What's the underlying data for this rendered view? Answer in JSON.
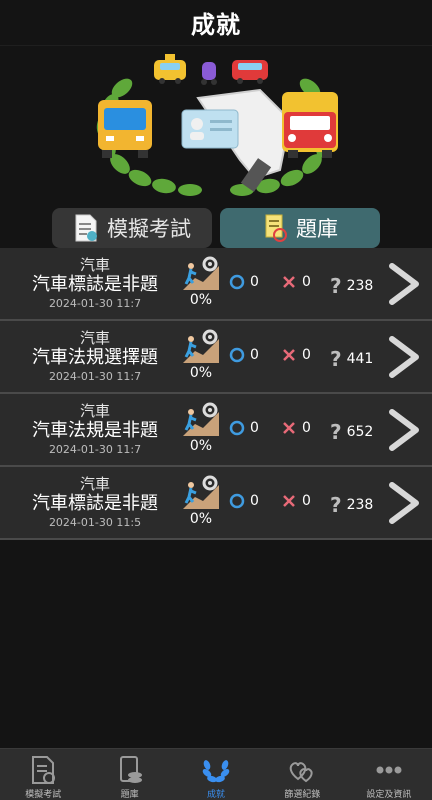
{
  "header": {
    "title": "成就"
  },
  "mode_toggle": {
    "exam_label": "模擬考試",
    "bank_label": "題庫",
    "selected": "bank"
  },
  "records": [
    {
      "category": "汽車",
      "title": "汽車標誌是非題",
      "date": "2024-01-30 11:7",
      "progress": "0%",
      "correct": "0",
      "wrong": "0",
      "unanswered": "238"
    },
    {
      "category": "汽車",
      "title": "汽車法規選擇題",
      "date": "2024-01-30 11:7",
      "progress": "0%",
      "correct": "0",
      "wrong": "0",
      "unanswered": "441"
    },
    {
      "category": "汽車",
      "title": "汽車法規是非題",
      "date": "2024-01-30 11:7",
      "progress": "0%",
      "correct": "0",
      "wrong": "0",
      "unanswered": "652"
    },
    {
      "category": "汽車",
      "title": "汽車標誌是非題",
      "date": "2024-01-30 11:5",
      "progress": "0%",
      "correct": "0",
      "wrong": "0",
      "unanswered": "238"
    }
  ],
  "tabbar": {
    "items": [
      {
        "label": "模擬考試",
        "icon": "exam-sheet-icon"
      },
      {
        "label": "題庫",
        "icon": "question-bank-icon"
      },
      {
        "label": "成就",
        "icon": "laurel-icon",
        "active": true
      },
      {
        "label": "篩選紀錄",
        "icon": "hearts-icon"
      },
      {
        "label": "設定及資訊",
        "icon": "more-dots-icon"
      }
    ]
  },
  "colors": {
    "background": "#141414",
    "row": "#2b2b2b",
    "active_toggle": "#3f6a6f",
    "correct": "#3f9be0",
    "wrong": "#e86a78",
    "tab_active": "#3a8ff0"
  }
}
